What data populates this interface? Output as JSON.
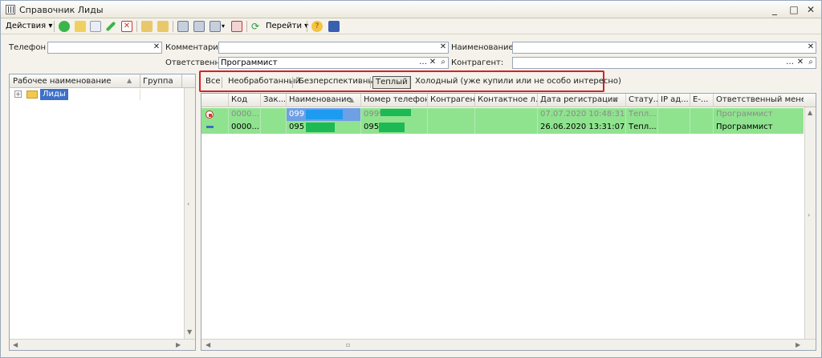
{
  "window": {
    "title": "Справочник Лиды",
    "controls": [
      "_",
      "□",
      "✕"
    ]
  },
  "toolbar": {
    "actions_label": "Действия",
    "goto_label": "Перейти"
  },
  "filters": {
    "phone_label": "Телефон :",
    "phone_value": "",
    "comment_label": "Комментарий:",
    "comment_value": "",
    "name_label": "Наименование :",
    "name_value": "",
    "responsible_label": "Ответственн...",
    "responsible_value": "Программист",
    "counterparty_label": "Контрагент:",
    "counterparty_value": ""
  },
  "tree": {
    "col_name": "Рабочее наименование",
    "col_group": "Группа",
    "item_label": "Лиды"
  },
  "tabs": [
    {
      "label": "Все"
    },
    {
      "label": "Необработанный"
    },
    {
      "label": "Безперспективный"
    },
    {
      "label": "Теплый"
    },
    {
      "label": "Холодный (уже купили или не особо интересно)"
    }
  ],
  "grid": {
    "columns": [
      "Код",
      "Зак...",
      "Наименование",
      "Номер телефона",
      "Контрагент",
      "Контактное л...",
      "Дата регистрации",
      "Стату...",
      "IP ад...",
      "E-...",
      "Ответственный менеджер"
    ],
    "rows": [
      {
        "code": "0000...",
        "name": "099",
        "phone": "0999",
        "date": "07.07.2020 10:48:31",
        "status": "Тепл...",
        "manager": "Программист"
      },
      {
        "code": "0000...",
        "name": "095",
        "phone": "095",
        "date": "26.06.2020 13:31:07",
        "status": "Тепл...",
        "manager": "Программист"
      }
    ]
  },
  "colors": {
    "row_bg": "#8fe38f",
    "highlight_border": "#d3202a",
    "redaction_blue": "#1d9bf0",
    "redaction_green": "#1db954"
  }
}
